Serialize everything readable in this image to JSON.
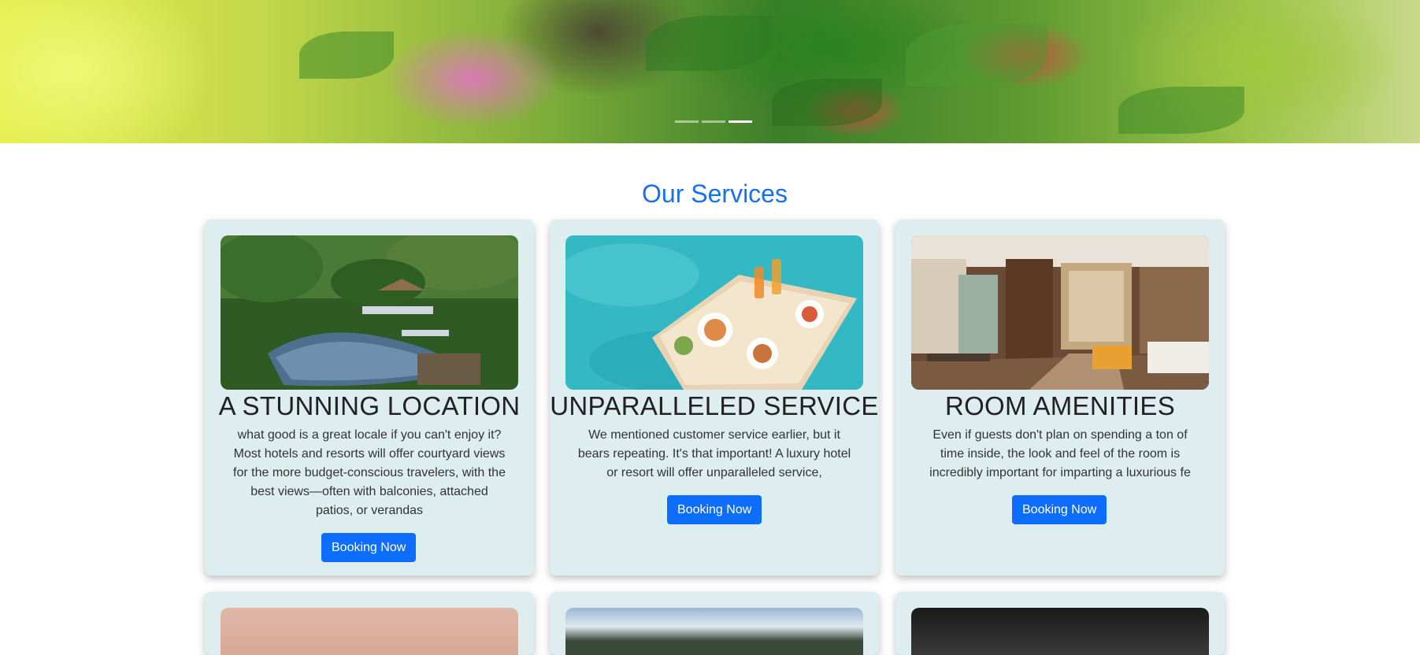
{
  "hero": {
    "active_slide": 3,
    "slide_count": 3
  },
  "services": {
    "title": "Our Services",
    "cards": [
      {
        "heading": "A STUNNING LOCATION",
        "text": "what good is a great locale if you can't enjoy it? Most hotels and resorts will offer courtyard views for the more budget-conscious travelers, with the best views—often with balconies, attached patios, or verandas",
        "button": "Booking Now",
        "image": "jungle-pool-image"
      },
      {
        "heading": "UNPARALLELED SERVICE",
        "text": "We mentioned customer service earlier, but it bears repeating. It's that important! A luxury hotel or resort will offer unparalleled service,",
        "button": "Booking Now",
        "image": "floating-breakfast-image"
      },
      {
        "heading": "ROOM AMENITIES",
        "text": "Even if guests don't plan on spending a ton of time inside, the look and feel of the room is incredibly important for imparting a luxurious fe",
        "button": "Booking Now",
        "image": "hotel-room-image"
      }
    ]
  },
  "colors": {
    "accent": "#0d6efd",
    "title": "#1a6ff0",
    "card_bg": "#deedef"
  }
}
